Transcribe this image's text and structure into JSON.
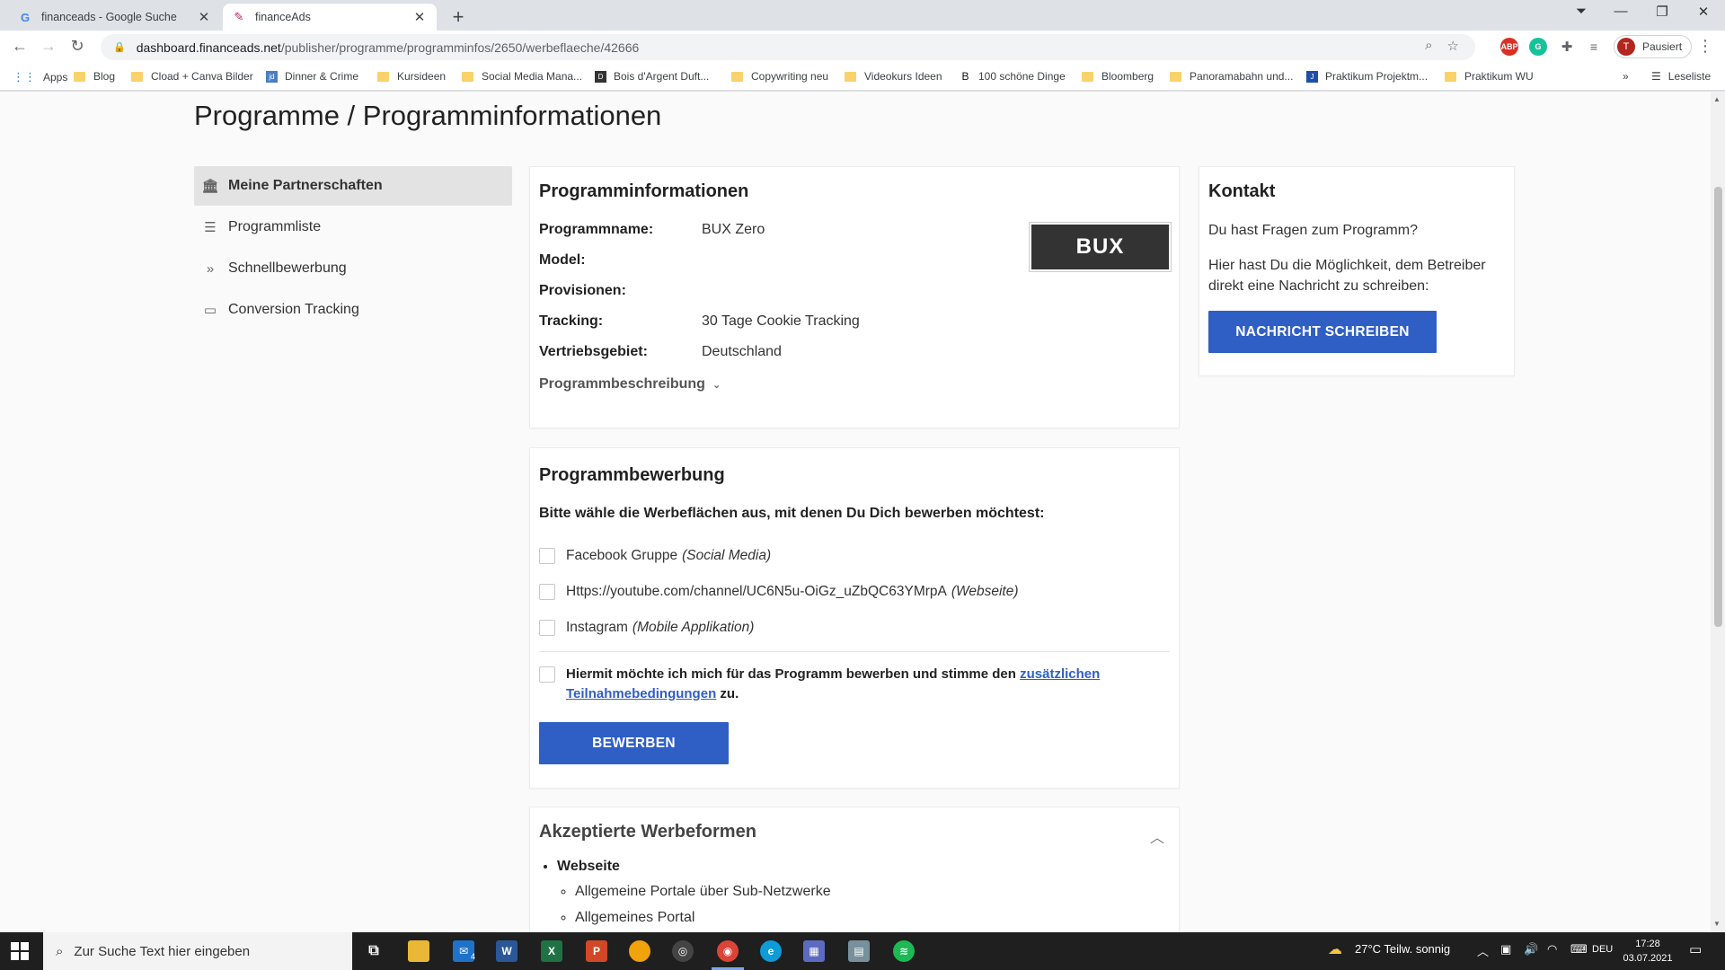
{
  "browser": {
    "tabs": [
      {
        "title": "financeads - Google Suche",
        "icon": "google-icon"
      },
      {
        "title": "financeAds",
        "icon": "financeads-icon"
      }
    ],
    "url_host": "dashboard.financeads.net",
    "url_path": "/publisher/programme/programminfos/2650/werbeflaeche/42666",
    "profile_initial": "T",
    "profile_status": "Pausiert",
    "bookmarks": [
      "Apps",
      "Blog",
      "Cload + Canva Bilder",
      "Dinner & Crime",
      "Kursideen",
      "Social Media Mana...",
      "Bois d'Argent Duft...",
      "Copywriting neu",
      "Videokurs Ideen",
      "100 schöne Dinge",
      "Bloomberg",
      "Panoramabahn und...",
      "Praktikum Projektm...",
      "Praktikum WU"
    ],
    "reading_list": "Leseliste"
  },
  "page": {
    "title": "Programme / Programminformationen"
  },
  "sidebar": {
    "items": [
      {
        "label": "Meine Partnerschaften",
        "icon": "bank-icon"
      },
      {
        "label": "Programmliste",
        "icon": "list-icon"
      },
      {
        "label": "Schnellbewerbung",
        "icon": "double-chevron-icon"
      },
      {
        "label": "Conversion Tracking",
        "icon": "monitor-icon"
      }
    ]
  },
  "program_info": {
    "heading": "Programminformationen",
    "logo_text": "BUX",
    "rows": [
      {
        "label": "Programmname:",
        "value": "BUX Zero"
      },
      {
        "label": "Model:",
        "value": ""
      },
      {
        "label": "Provisionen:",
        "value": ""
      },
      {
        "label": "Tracking:",
        "value": "30 Tage Cookie Tracking"
      },
      {
        "label": "Vertriebsgebiet:",
        "value": "Deutschland"
      }
    ],
    "description_toggle": "Programmbeschreibung"
  },
  "contact": {
    "heading": "Kontakt",
    "question": "Du hast Fragen zum Programm?",
    "text": "Hier hast Du die Möglichkeit, dem Betreiber direkt eine Nachricht zu schreiben:",
    "button": "NACHRICHT SCHREIBEN"
  },
  "application": {
    "heading": "Programmbewerbung",
    "lead": "Bitte wähle die Werbeflächen aus, mit denen Du Dich bewerben möchtest:",
    "options": [
      {
        "name": "Facebook Gruppe",
        "type": "(Social Media)"
      },
      {
        "name": "Https://youtube.com/channel/UC6N5u-OiGz_uZbQC63YMrpA",
        "type": "(Webseite)"
      },
      {
        "name": "Instagram",
        "type": "(Mobile Applikation)"
      }
    ],
    "terms_before": "Hiermit möchte ich mich für das Programm bewerben und stimme den ",
    "terms_link": "zusätzlichen Teilnahmebedingungen",
    "terms_after": " zu.",
    "button": "BEWERBEN"
  },
  "accepted_forms": {
    "heading": "Akzeptierte Werbeformen",
    "group": "Webseite",
    "items": [
      "Allgemeine Portale über Sub-Netzwerke",
      "Allgemeines Portal"
    ]
  },
  "taskbar": {
    "search_placeholder": "Zur Suche Text hier eingeben",
    "weather": "27°C  Teilw. sonnig",
    "language": "DEU",
    "time": "17:28",
    "date": "03.07.2021",
    "mail_badge": "4"
  },
  "colors": {
    "accent": "#2f5fc4",
    "sidebar_active": "#e3e3e3"
  }
}
